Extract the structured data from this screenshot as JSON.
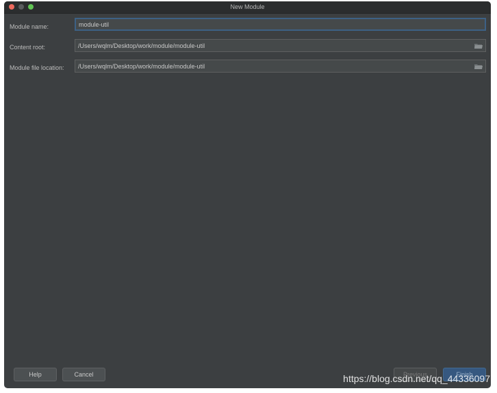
{
  "window": {
    "title": "New Module"
  },
  "form": {
    "module_name": {
      "label": "Module name:",
      "value": "module-util"
    },
    "content_root": {
      "label": "Content root:",
      "value": "/Users/wqlm/Desktop/work/module/module-util"
    },
    "module_file_location": {
      "label": "Module file location:",
      "value": "/Users/wqlm/Desktop/work/module/module-util"
    }
  },
  "buttons": {
    "help": "Help",
    "cancel": "Cancel",
    "previous": "Previous",
    "finish": "Finish"
  },
  "watermark": "https://blog.csdn.net/qq_44336097",
  "icons": {
    "browse": "folder-icon"
  },
  "colors": {
    "window_bg": "#3c3f41",
    "field_bg": "#45494a",
    "focus_border": "#3d6185",
    "default_button": "#365880"
  }
}
